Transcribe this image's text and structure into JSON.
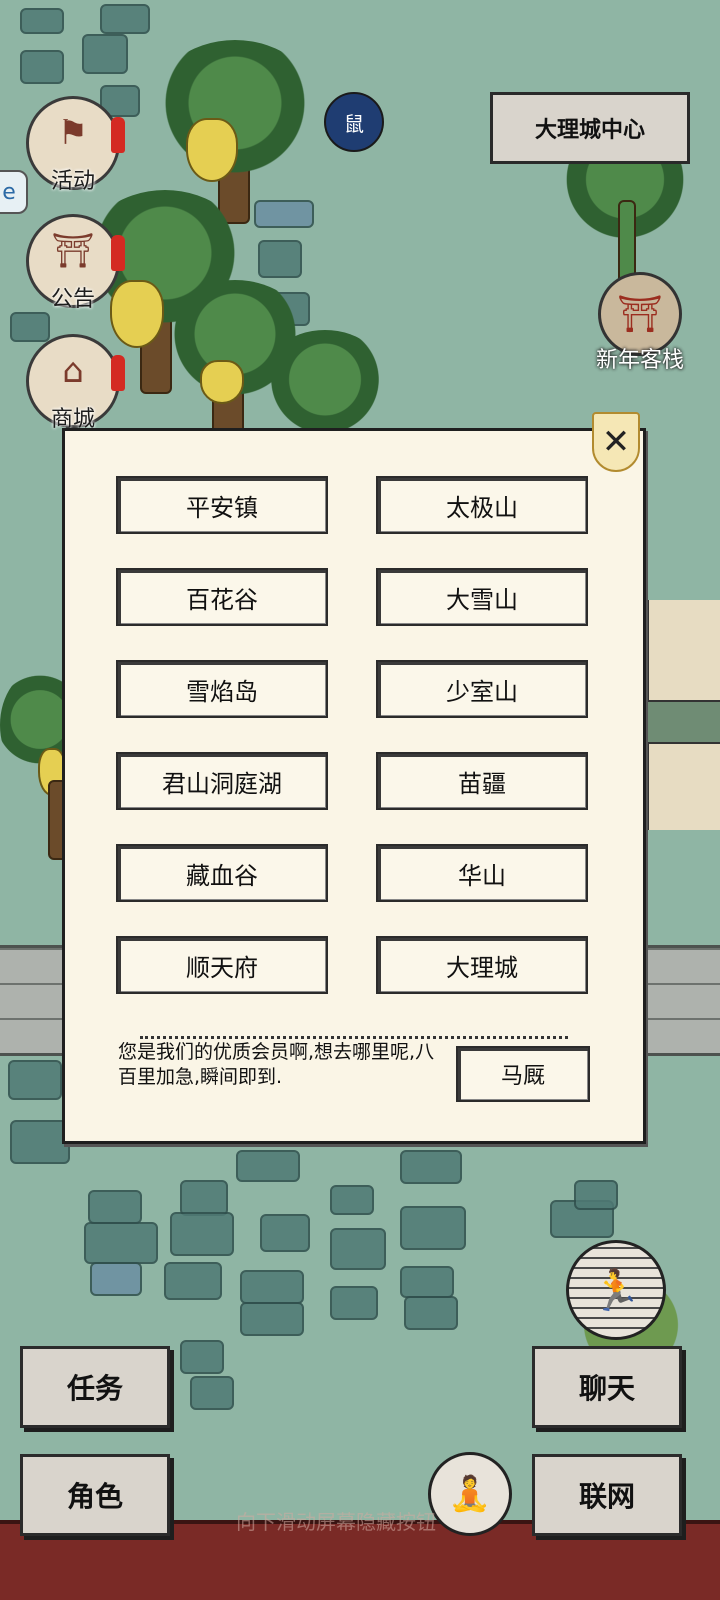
{
  "top_left_menu": [
    {
      "label": "活动",
      "icon": "banner-icon"
    },
    {
      "label": "公告",
      "icon": "notice-board-icon"
    },
    {
      "label": "商城",
      "icon": "shop-icon"
    }
  ],
  "moon_badge": "鼠",
  "location": {
    "title": "大理城中心"
  },
  "inn": {
    "label": "新年客栈",
    "icon": "inn-icon"
  },
  "dialog": {
    "destinations": [
      "平安镇",
      "太极山",
      "百花谷",
      "大雪山",
      "雪焰岛",
      "少室山",
      "君山洞庭湖",
      "苗疆",
      "藏血谷",
      "华山",
      "顺天府",
      "大理城"
    ],
    "description": "您是我们的优质会员啊,想去哪里呢,八百里加急,瞬间即到.",
    "action_label": "马厩",
    "close_symbol": "✕"
  },
  "bottom_buttons": {
    "tasks": "任务",
    "chat": "聊天",
    "character": "角色",
    "network": "联网"
  },
  "hint_text": "向下滑动屏幕隐藏按钮",
  "colors": {
    "ground": "#8fb5a4",
    "panel": "#faf5e6",
    "alert": "#d42a22"
  }
}
